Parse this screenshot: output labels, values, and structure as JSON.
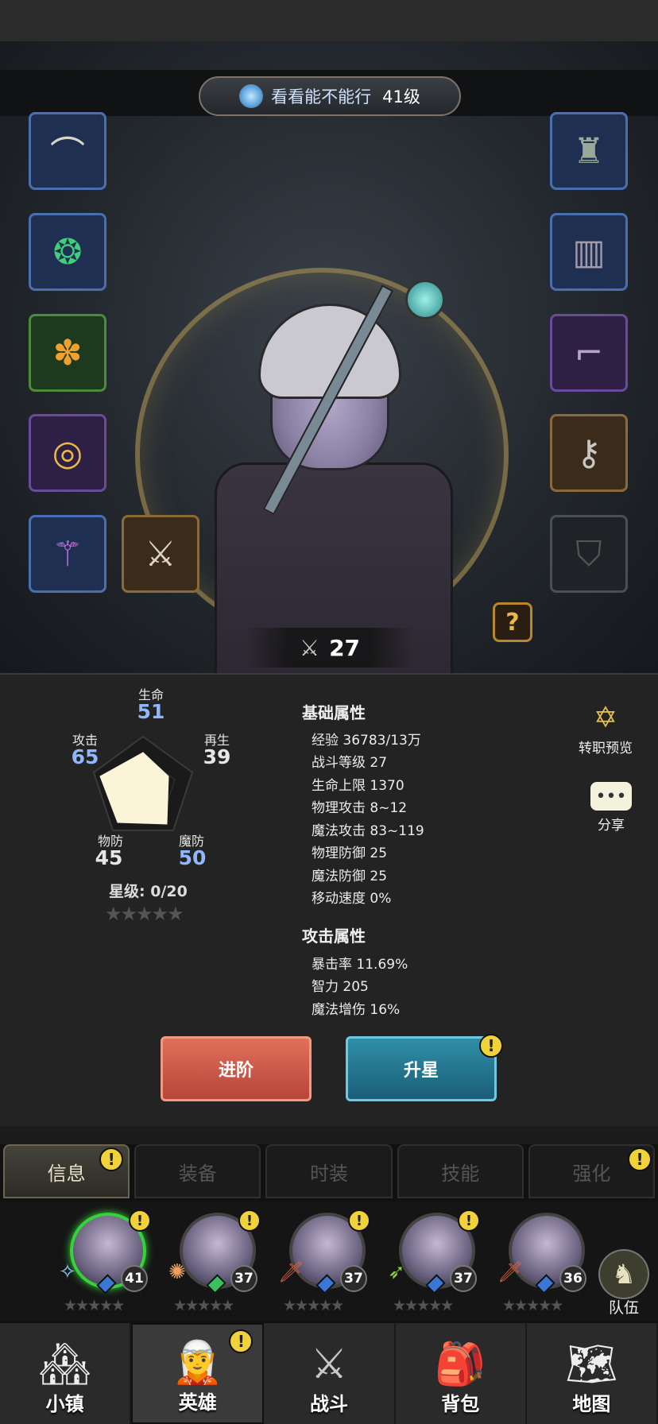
{
  "hero": {
    "name": "看看能不能行",
    "level": "41级",
    "power": "27"
  },
  "equipment": {
    "left": [
      {
        "icon": "helmet-icon",
        "glyph": "⌒",
        "rarity": "blue"
      },
      {
        "icon": "amulet-icon",
        "glyph": "❂",
        "rarity": "blue"
      },
      {
        "icon": "charm-icon",
        "glyph": "✽",
        "rarity": "green"
      },
      {
        "icon": "ring-icon",
        "glyph": "◎",
        "rarity": "purple"
      },
      {
        "icon": "wand-icon",
        "glyph": "⚚",
        "rarity": "blue"
      }
    ],
    "offhand": {
      "icon": "claw-icon",
      "glyph": "⚔",
      "rarity": "brown"
    },
    "right": [
      {
        "icon": "armor-icon",
        "glyph": "♜",
        "rarity": "blue"
      },
      {
        "icon": "pants-icon",
        "glyph": "▥",
        "rarity": "blue"
      },
      {
        "icon": "boots-icon",
        "glyph": "⌐",
        "rarity": "purple"
      },
      {
        "icon": "locked-ring-icon",
        "glyph": "⚷",
        "rarity": "brown"
      },
      {
        "icon": "empty-shield-icon",
        "glyph": "⛉",
        "rarity": "gray"
      }
    ],
    "help": "?"
  },
  "radar": {
    "life_label": "生命",
    "life": "51",
    "regen_label": "再生",
    "regen": "39",
    "mdef_label": "魔防",
    "mdef": "50",
    "pdef_label": "物防",
    "pdef": "45",
    "atk_label": "攻击",
    "atk": "65"
  },
  "star_level": "星级: 0/20",
  "star_glyphs": "★★★★★",
  "basic_attrs": {
    "title": "基础属性",
    "lines": [
      "经验 36783/13万",
      "战斗等级 27",
      "生命上限 1370",
      "物理攻击 8~12",
      "魔法攻击 83~119",
      "物理防御 25",
      "魔法防御 25",
      "移动速度 0%"
    ]
  },
  "attack_attrs": {
    "title": "攻击属性",
    "lines": [
      "暴击率 11.69%",
      "智力 205",
      "魔法增伤 16%"
    ]
  },
  "side_buttons": {
    "job_preview": "转职预览",
    "share": "分享",
    "chat_glyph": "•••",
    "job_glyph": "✡"
  },
  "actions": {
    "advance": "进阶",
    "star_up": "升星",
    "alert_glyph": "!"
  },
  "tabs": [
    "信息",
    "装备",
    "时装",
    "技能",
    "强化"
  ],
  "roster": {
    "heroes": [
      {
        "level": "41",
        "weapon": "✧",
        "active": true
      },
      {
        "level": "37",
        "weapon": "✺",
        "active": false
      },
      {
        "level": "37",
        "weapon": "🗡",
        "active": false
      },
      {
        "level": "37",
        "weapon": "➶",
        "active": false
      },
      {
        "level": "36",
        "weapon": "🗡",
        "active": false
      }
    ],
    "team_label": "队伍",
    "team_glyph": "♞"
  },
  "nav": [
    {
      "label": "小镇",
      "glyph": "🏘"
    },
    {
      "label": "英雄",
      "glyph": "🧝"
    },
    {
      "label": "战斗",
      "glyph": "⚔"
    },
    {
      "label": "背包",
      "glyph": "🎒"
    },
    {
      "label": "地图",
      "glyph": "🗺"
    }
  ],
  "colors": {
    "accent_blue": "#8fb6ff",
    "advance_red": "#e0705a",
    "starup_teal": "#2f8fa8",
    "active_ring": "#37d23a",
    "alert_yellow": "#f2d23a"
  }
}
